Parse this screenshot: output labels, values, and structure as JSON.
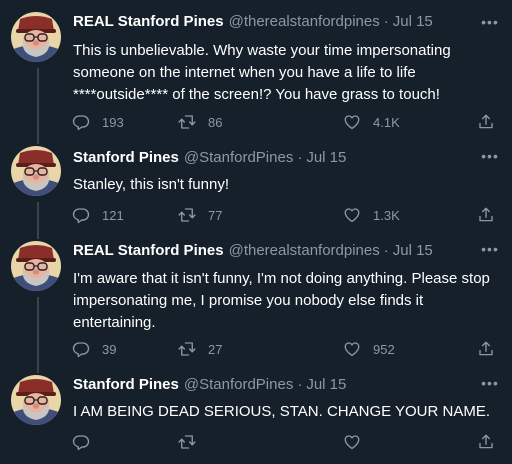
{
  "tweets": [
    {
      "name": "REAL Stanford Pines",
      "handle": "@therealstanfordpines",
      "sep": "·",
      "date": "Jul 15",
      "text": "This is unbelievable. Why waste your time impersonating someone on the internet when you have a life to life ****outside**** of the screen!? You have grass to touch!",
      "replies": "193",
      "retweets": "86",
      "likes": "4.1K",
      "more": "•••"
    },
    {
      "name": "Stanford Pines",
      "handle": "@StanfordPines",
      "sep": "·",
      "date": "Jul 15",
      "text": "Stanley, this isn't funny!",
      "replies": "121",
      "retweets": "77",
      "likes": "1.3K",
      "more": "•••"
    },
    {
      "name": "REAL Stanford Pines",
      "handle": "@therealstanfordpines",
      "sep": "·",
      "date": "Jul 15",
      "text": "I'm aware that it isn't funny, I'm not doing anything. Please stop impersonating me, I promise you nobody else finds it entertaining.",
      "replies": "39",
      "retweets": "27",
      "likes": "952",
      "more": "•••"
    },
    {
      "name": "Stanford Pines",
      "handle": "@StanfordPines",
      "sep": "·",
      "date": "Jul 15",
      "text": "I AM BEING DEAD SERIOUS, STAN. CHANGE YOUR NAME.",
      "replies": "",
      "retweets": "",
      "likes": "",
      "more": "•••"
    }
  ],
  "icons": {
    "reply": "reply-icon",
    "retweet": "retweet-icon",
    "like": "like-icon",
    "share": "share-icon",
    "more": "more-icon"
  },
  "colors": {
    "background": "#15202b",
    "muted": "#8b98a5",
    "thread_line": "#38444d",
    "text": "#ffffff"
  }
}
